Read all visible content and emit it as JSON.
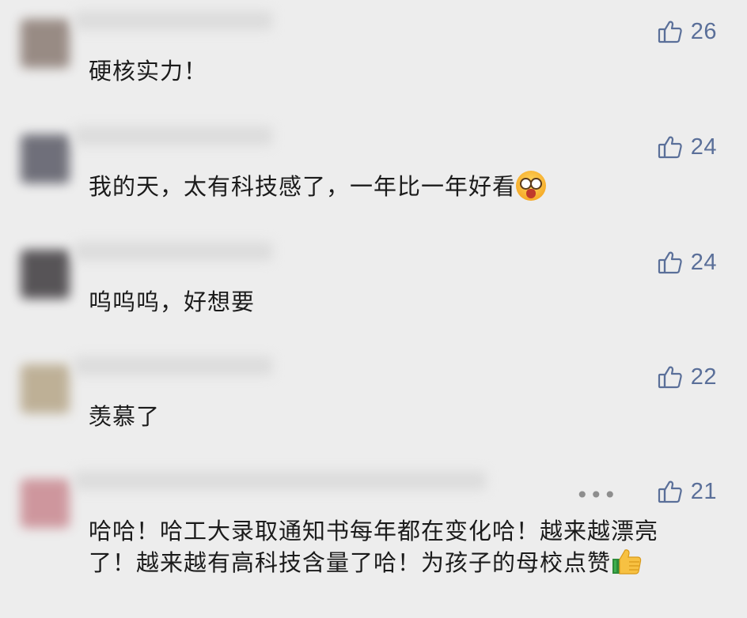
{
  "comments": [
    {
      "likes": "26",
      "text": "硬核实力！",
      "avatar_color": "#8a7a72"
    },
    {
      "likes": "24",
      "text": "我的天，太有科技感了，一年比一年好看",
      "avatar_color": "#5a5a66"
    },
    {
      "likes": "24",
      "text": "呜呜呜，好想要",
      "avatar_color": "#3e3a3e"
    },
    {
      "likes": "22",
      "text": "羡慕了",
      "avatar_color": "#b6a688"
    },
    {
      "likes": "21",
      "text_line1": "哈哈！哈工大录取通知书每年都在变化哈！越来越漂亮",
      "text_line2": "了！越来越有高科技含量了哈！为孩子的母校点赞",
      "avatar_color": "#c98890"
    }
  ],
  "more_label": "•••",
  "icons": {
    "like": "thumbs-up-outline-icon",
    "emoji_1": "astonished-face-emoji",
    "emoji_2": "thumbs-up-emoji"
  },
  "colors": {
    "background": "#ededed",
    "like_color": "#5a6f99",
    "text_color": "#1b1b1b"
  }
}
